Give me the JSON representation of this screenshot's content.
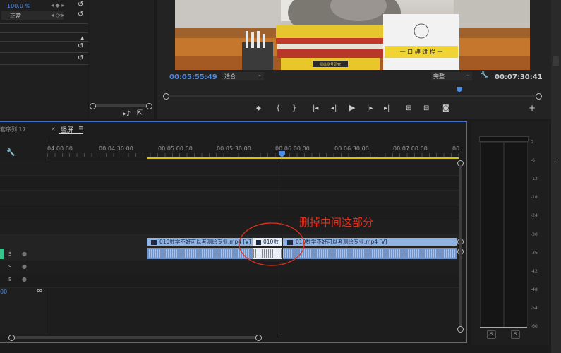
{
  "effect_controls": {
    "opacity_value": "100.0 %",
    "blend_mode": "正常"
  },
  "program": {
    "current_time": "00:05:55:49",
    "fit_label": "适合",
    "quality_label": "完整",
    "duration": "00:07:30:41",
    "photo": {
      "book_title": "一 口 碑 讲 程 一",
      "book_spine": "测绘测号研究"
    }
  },
  "timeline": {
    "sequence_name": "套序列 17",
    "tab_label": "竖屏",
    "ruler": [
      "04:00:00",
      "00:04:30:00",
      "00:05:00:00",
      "00:05:30:00",
      "00:06:00:00",
      "00:06:30:00",
      "00:07:00:00",
      "00:"
    ],
    "clip_label_1": "010数学不好可以考测绘专业.mp4 [V]",
    "clip_label_2": "010数",
    "clip_label_3": "010数学不好可以考测绘专业.mp4 [V]",
    "track_s": "S",
    "timecode_zero": "00"
  },
  "annotation": {
    "text": "删掉中间这部分",
    "color": "#e0301e"
  },
  "meter": {
    "scale": [
      "0",
      "-6",
      "-12",
      "-18",
      "-24",
      "-30",
      "-36",
      "-42",
      "-48",
      "-54",
      "-60",
      "-66"
    ],
    "solo": [
      "S",
      "S"
    ]
  },
  "colors": {
    "accent": "#4d8be8",
    "work_area": "#d8c400",
    "clip": "#8fb3e3"
  }
}
